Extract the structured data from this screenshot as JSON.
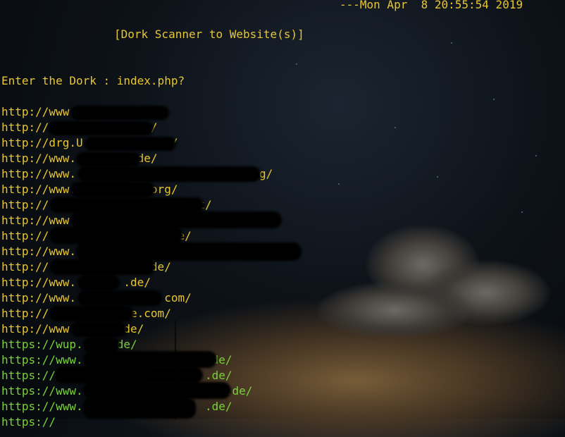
{
  "terminal": {
    "date_line": "---Mon Apr  8 20:55:54 2019",
    "title": "[Dork Scanner to Website(s)]",
    "prompt": "Enter the Dork : index.php?"
  },
  "results": [
    "http://www          .de/",
    "http://               /",
    "http://drg.U          .de/",
    "http://www.         de/",
    "http://www.                        .org/",
    "http://www.           org/",
    "http://                   .net/",
    "http://www                           .de/",
    "http://                 .de/",
    "http://www.                             .de/",
    "http://              .de/",
    "http://www.       .de/",
    "http://www.             com/",
    "http://            e.com/",
    "http://www       .de/",
    "https://wup.    .de/",
    "https://www.                   de/",
    "https://                      .de/",
    "https://www.                     .de/",
    "https://www.                  .de/"
  ],
  "colors": {
    "http": "#e8c632",
    "https": "#7ad13a",
    "background": "#0d1218"
  }
}
